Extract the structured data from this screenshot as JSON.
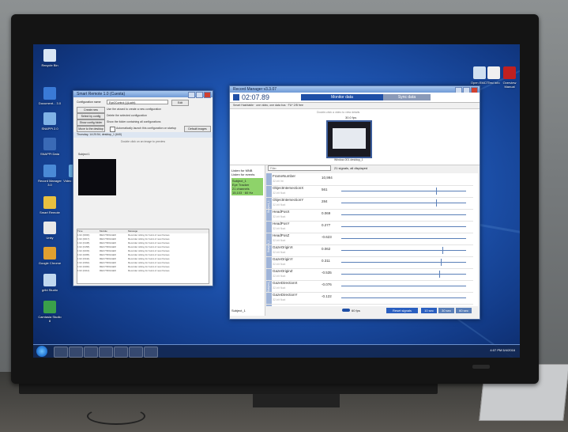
{
  "desktop": {
    "left_icons": [
      {
        "label": "Recycle Bin",
        "icon": "recycle-bin-icon",
        "color": "#d9e6f5"
      },
      {
        "label": "Document... 3.0",
        "icon": "document-icon",
        "color": "#3a7ad6"
      },
      {
        "label": "SNAPPi 2.0",
        "icon": "snappi-icon",
        "color": "#7fb2e6"
      },
      {
        "label": "SNAPPi Data",
        "icon": "folder-icon",
        "color": "#3a6ab6"
      },
      {
        "label": "Record Manager 3.0",
        "icon": "record-manager-icon",
        "color": "#4a8ad6"
      },
      {
        "label": "Video Streaming",
        "icon": "video-icon",
        "color": "#6ab0e8"
      },
      {
        "label": "Smart Remote",
        "icon": "smart-remote-icon",
        "color": "#e8c040"
      },
      {
        "label": "Unity",
        "icon": "unity-icon",
        "color": "#e8e8e8"
      },
      {
        "label": "Google Chrome",
        "icon": "chrome-icon",
        "color": "#e0a030"
      },
      {
        "label": "gribi Studio",
        "icon": "gribi-icon",
        "color": "#c0d8f0"
      },
      {
        "label": "Camtasia Studio 8",
        "icon": "camtasia-icon",
        "color": "#3aa04a"
      }
    ],
    "right_icons": [
      {
        "label": "Open EMCT",
        "icon": "open-emct-icon",
        "color": "#d0e0f0"
      },
      {
        "label": "Test Info",
        "icon": "text-file-icon",
        "color": "#f0f0f0"
      },
      {
        "label": "Overview Manual",
        "icon": "pdf-icon",
        "color": "#c02020"
      }
    ]
  },
  "config_window": {
    "title": "Smart Remote 1.0 (Cuesta)",
    "config_label": "Configuration name",
    "config_value": "Eye2Control ()(Lucht)",
    "edit_button": "Edit",
    "options": [
      {
        "button": "Create new",
        "desc": "Use the wizard to create a new configuration"
      },
      {
        "button": "Select by config",
        "desc": "Delete the selected configuration"
      },
      {
        "button": "Show config folder",
        "desc": "Show the folder containing all configurations"
      },
      {
        "button": "Move to the desktop",
        "desc": "Automatically launch this configuration on startup"
      }
    ],
    "default_button": "Default images",
    "timestamp": "Thursday, 14:20:54, desktop_1 (640)",
    "hint": "Double click on an image to preview",
    "subject_label": "Subject 1",
    "log_headers": [
      "Time",
      "Module",
      "Message"
    ],
    "log_rows": [
      [
        "1:02 (0000)",
        "REC/TRIGGER",
        "Recorder sitting for burst of new frames"
      ],
      [
        "1:02 (0017)",
        "REC/TRIGGER",
        "Recorder sitting for burst of new frames"
      ],
      [
        "1:02 (0138)",
        "REC/TRIGGER",
        "Recorder sitting for burst of new frames"
      ],
      [
        "1:02 (0158)",
        "REC/TRIGGER",
        "Recorder sitting for burst of new frames"
      ],
      [
        "1:02 (0233)",
        "REC/TRIGGER",
        "Recorder sitting for burst of new frames"
      ],
      [
        "1:02 (0295)",
        "REC/TRIGGER",
        "Recorder sitting for burst of new frames"
      ],
      [
        "1:02 (0344)",
        "REC/TRIGGER",
        "Recorder sitting for burst of new frames"
      ],
      [
        "1:02 (0362)",
        "REC/TRIGGER",
        "Recorder sitting for burst of new frames"
      ],
      [
        "1:02 (0400)",
        "REC/TRIGGER",
        "Recorder sitting for burst of new frames"
      ],
      [
        "1:02 (0412)",
        "REC/TRIGGER",
        "Recorder sitting for burst of new frames"
      ]
    ]
  },
  "record_manager": {
    "title": "Record Manager v3.3.07",
    "elapsed": "02:07.89",
    "tab_monitor": "Monitor data",
    "tab_sync": "Sync data",
    "subtitle": "Smart Hashtable  ·  one video, one data bus  ·  FU* 2/B free",
    "hint": "Double-click a video to view details",
    "fps": "30.0 fps",
    "video_caption": "Window-001  desktop_1",
    "listen_mnb": "Listen for MNB",
    "listen_events": "Listen for events",
    "subjects": [
      "Subject_1",
      "Eye Tracker",
      "21 channels",
      "15,103 · 60 Hz"
    ],
    "search_placeholder": "Filter",
    "signal_count": "21 signals, all displayed",
    "group_labels": [
      "Subject_1",
      "Subject_1",
      "Subject_1"
    ],
    "signals": [
      {
        "name": "FrameNumber",
        "unit": "32-bit Int",
        "value": "10,994"
      },
      {
        "name": "ObjectIntersectionX",
        "unit": "32-bit float",
        "value": "561"
      },
      {
        "name": "ObjectIntersectionY",
        "unit": "32-bit float",
        "value": "284"
      },
      {
        "name": "HeadPosX",
        "unit": "32-bit float",
        "value": "0.069"
      },
      {
        "name": "HeadPosY",
        "unit": "32-bit float",
        "value": "0.277"
      },
      {
        "name": "HeadPosZ",
        "unit": "32-bit float",
        "value": "-0.623"
      },
      {
        "name": "GazeOriginX",
        "unit": "32-bit float",
        "value": "0.062"
      },
      {
        "name": "GazeOriginY",
        "unit": "32-bit float",
        "value": "0.311"
      },
      {
        "name": "GazeOriginZ",
        "unit": "32-bit float",
        "value": "-0.535"
      },
      {
        "name": "GazeDirectionX",
        "unit": "32-bit float",
        "value": "-0.076"
      },
      {
        "name": "GazeDirectionY",
        "unit": "32-bit float",
        "value": "-0.122"
      }
    ],
    "bottom_subject": "Subject_1",
    "zoom_label": "60 fps",
    "reset_button": "Reset signals",
    "time_buttons": [
      "10 sec",
      "30 sec",
      "60 sec"
    ]
  },
  "taskbar": {
    "clock": "4:07 PM  5/4/2016",
    "buttons": [
      "explorer",
      "chrome",
      "folder",
      "media",
      "record-manager",
      "smart-remote",
      "camtasia"
    ]
  }
}
